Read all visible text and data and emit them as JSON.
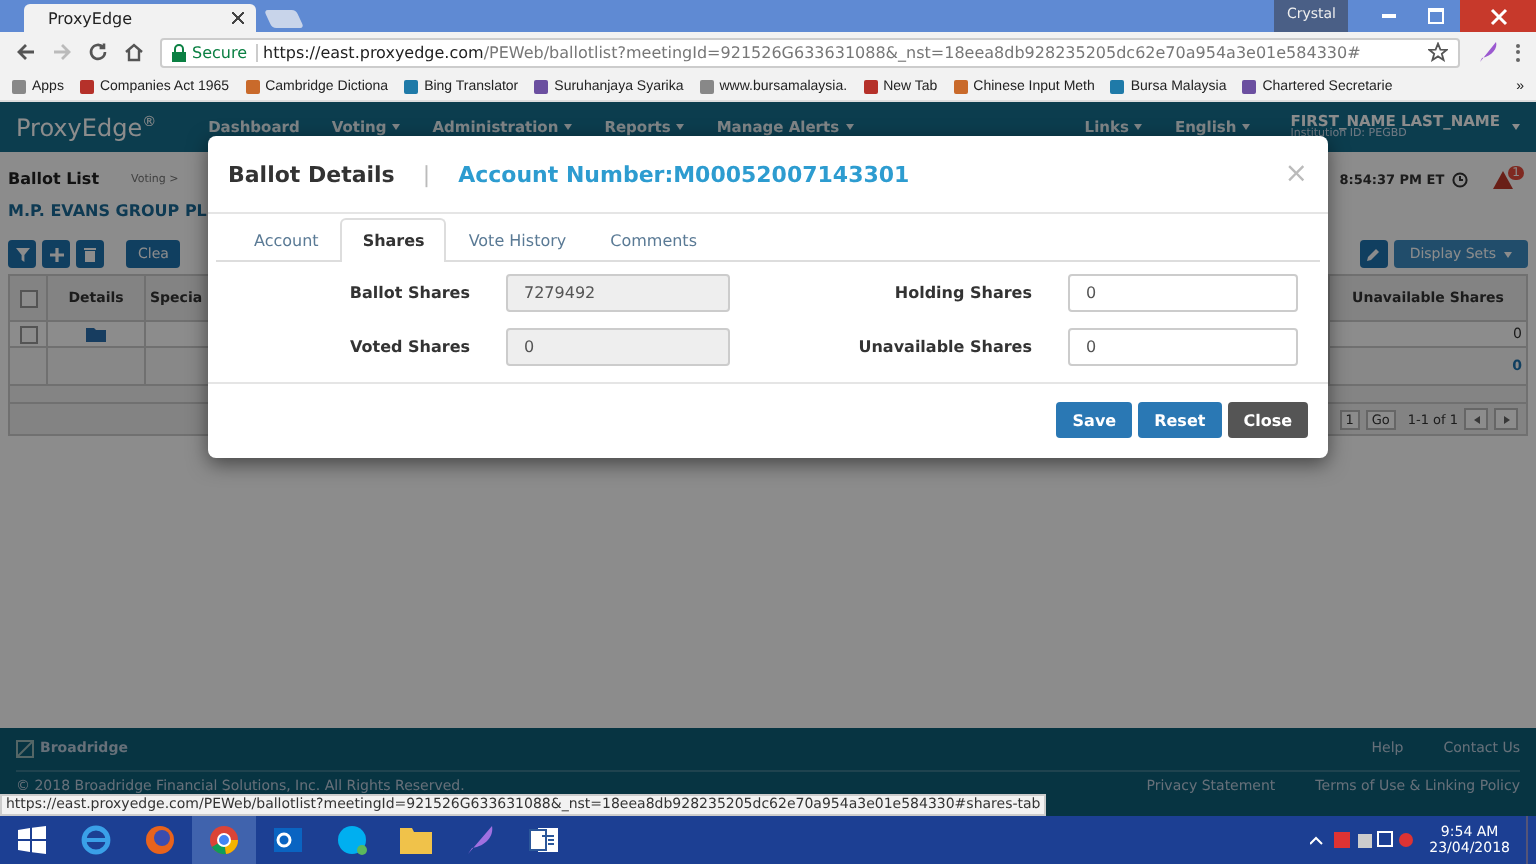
{
  "browser": {
    "tab_title": "ProxyEdge",
    "user": "Crystal",
    "secure_label": "Secure",
    "url_host": "https://east.proxyedge.com",
    "url_path": "/PEWeb/ballotlist?meetingId=921526G633631088&_nst=18eea8db928235205dc62e70a954a3e01e584330#",
    "bookmarks": [
      "Apps",
      "Companies Act 1965",
      "Cambridge Dictiona",
      "Bing Translator",
      "Suruhanjaya Syarika",
      "www.bursamalaysia.",
      "New Tab",
      "Chinese Input Meth",
      "Bursa Malaysia",
      "Chartered Secretarie"
    ],
    "more": "»"
  },
  "nav": {
    "logo": "ProxyEdge",
    "logo_mark": "®",
    "menu": [
      {
        "label": "Dashboard",
        "dropdown": false
      },
      {
        "label": "Voting",
        "dropdown": true
      },
      {
        "label": "Administration",
        "dropdown": true
      },
      {
        "label": "Reports",
        "dropdown": true
      },
      {
        "label": "Manage Alerts",
        "dropdown": true
      }
    ],
    "right_menu": [
      {
        "label": "Links",
        "dropdown": true
      },
      {
        "label": "English",
        "dropdown": true
      }
    ],
    "user_name": "FIRST_NAME LAST_NAME",
    "institution": "Institution ID: PEGBD"
  },
  "page": {
    "title": "Ballot List",
    "breadcrumb": "Voting >",
    "company": "M.P. EVANS GROUP PL",
    "time": "8:54:37 PM ET",
    "alert_count": "1",
    "clear_button": "Clea",
    "display_sets": "Display Sets",
    "select_all": {
      "checked": false
    },
    "row_checked": false,
    "columns": [
      "Details",
      "Specia"
    ],
    "right_column": "Unavailable Shares",
    "right_cells": [
      "0",
      "0"
    ],
    "page_number": "1",
    "go": "Go",
    "range": "1-1 of 1"
  },
  "modal": {
    "title": "Ballot Details",
    "separator": "|",
    "account": "Account Number:M00052007143301",
    "close": "×",
    "tabs": [
      {
        "label": "Account",
        "selected": false
      },
      {
        "label": "Shares",
        "selected": true
      },
      {
        "label": "Vote History",
        "selected": false
      },
      {
        "label": "Comments",
        "selected": false
      }
    ],
    "fields": [
      {
        "label": "Ballot Shares",
        "value": "7279492",
        "disabled": true
      },
      {
        "label": "Holding Shares",
        "value": "0",
        "disabled": false
      },
      {
        "label": "Voted Shares",
        "value": "0",
        "disabled": true
      },
      {
        "label": "Unavailable Shares",
        "value": "0",
        "disabled": false
      }
    ],
    "buttons": [
      {
        "label": "Save",
        "kind": "primary"
      },
      {
        "label": "Reset",
        "kind": "primary"
      },
      {
        "label": "Close",
        "kind": "dark"
      }
    ]
  },
  "footer": {
    "brand": "Broadridge",
    "links": [
      "Help",
      "Contact Us"
    ],
    "copyright": "© 2018 Broadridge Financial Solutions, Inc. All Rights Reserved.",
    "legal_links": [
      "Privacy Statement",
      "Terms of Use & Linking Policy"
    ]
  },
  "status_url": "https://east.proxyedge.com/PEWeb/ballotlist?meetingId=921526G633631088&_nst=18eea8db928235205dc62e70a954a3e01e584330#shares-tab",
  "taskbar": {
    "time": "9:54 AM",
    "date": "23/04/2018"
  }
}
